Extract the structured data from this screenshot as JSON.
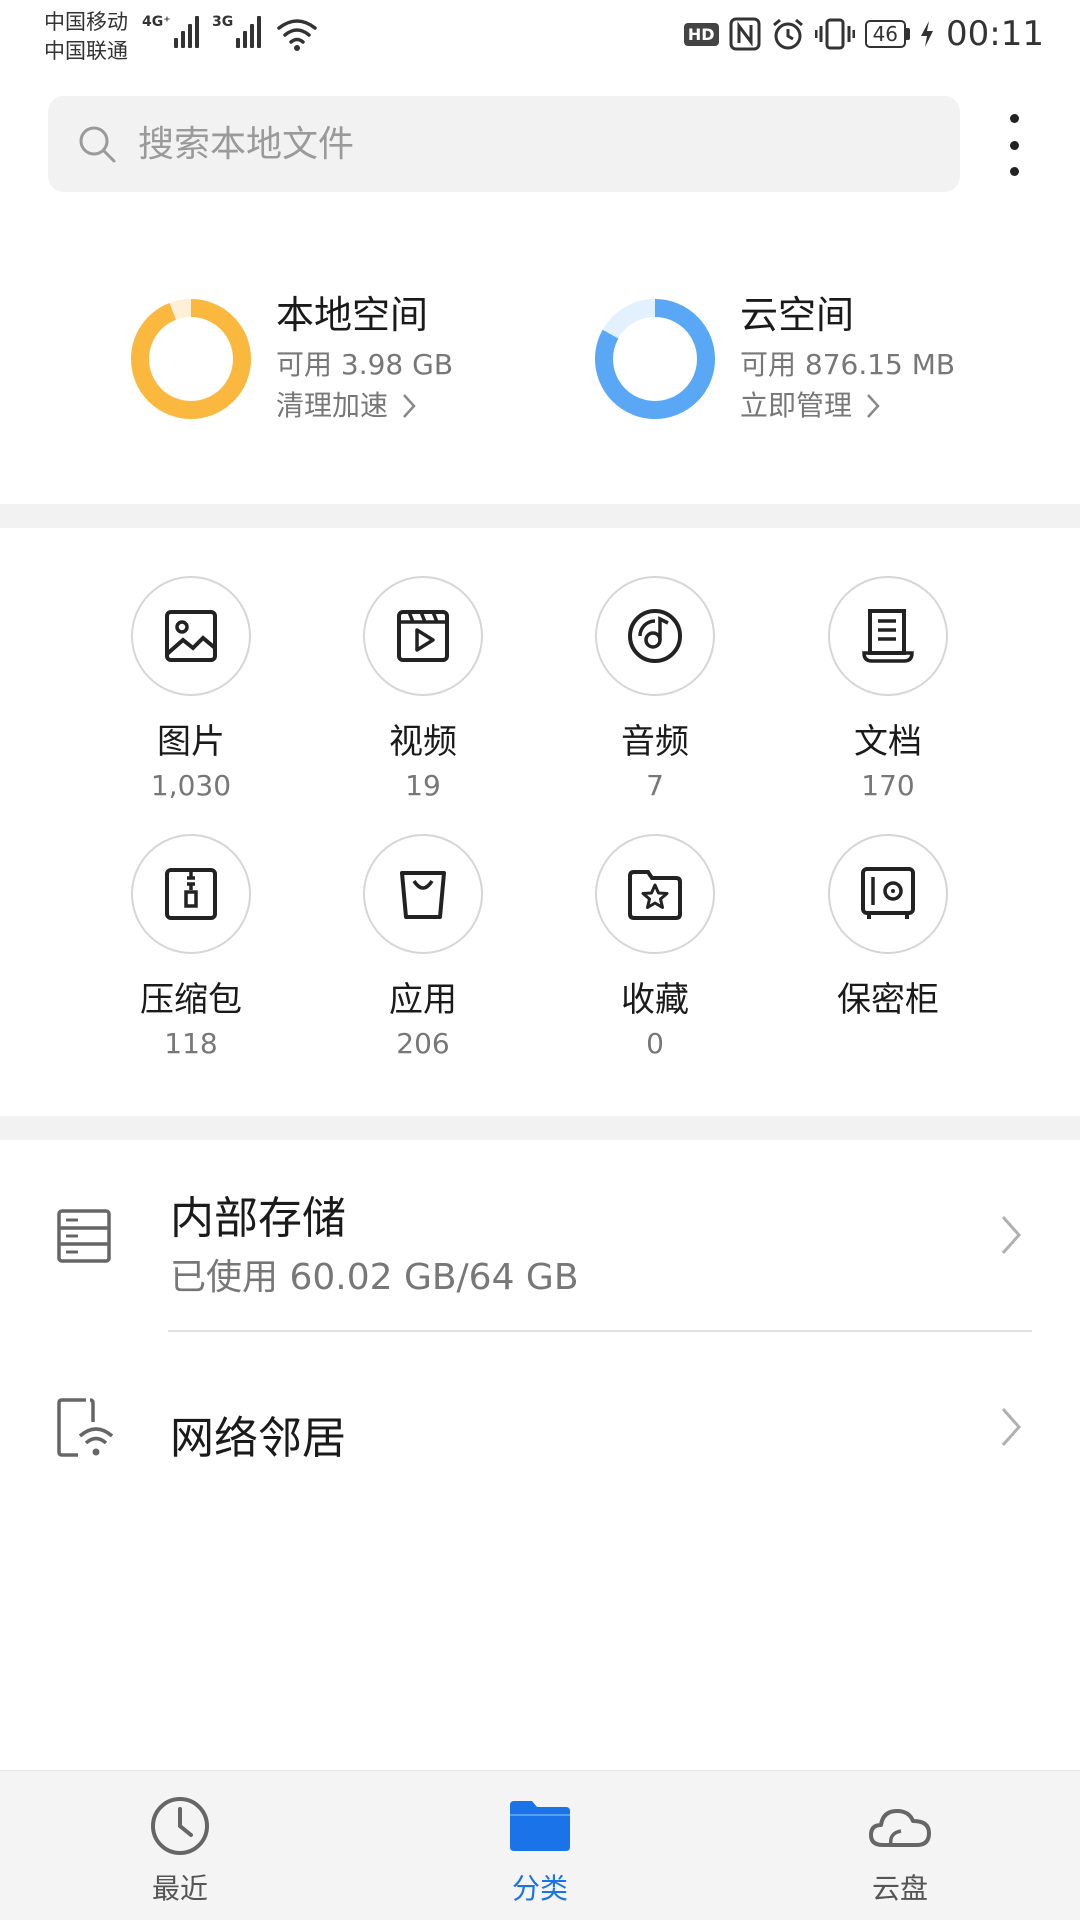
{
  "status_bar": {
    "carrier_1": "中国移动",
    "carrier_2": "中国联通",
    "sim1_network": "4G⁺",
    "sim2_network": "3G",
    "hd_badge": "HD",
    "battery": "46",
    "time": "00:11"
  },
  "search": {
    "placeholder": "搜索本地文件",
    "icon": "search-icon"
  },
  "menu": {
    "icon": "more-vertical-icon"
  },
  "storage": {
    "local": {
      "title": "本地空间",
      "available": "可用 3.98 GB",
      "action": "清理加速",
      "used_fraction": 0.94,
      "color": "#FBB83F",
      "track_color": "#FDF0D6"
    },
    "cloud": {
      "title": "云空间",
      "available": "可用 876.15 MB",
      "action": "立即管理",
      "used_fraction": 0.83,
      "color": "#5AA8F5",
      "track_color": "#E3F0FD"
    }
  },
  "categories": [
    {
      "label": "图片",
      "count": "1,030",
      "icon": "image-icon"
    },
    {
      "label": "视频",
      "count": "19",
      "icon": "video-icon"
    },
    {
      "label": "音频",
      "count": "7",
      "icon": "audio-icon"
    },
    {
      "label": "文档",
      "count": "170",
      "icon": "document-icon"
    },
    {
      "label": "压缩包",
      "count": "118",
      "icon": "zip-icon"
    },
    {
      "label": "应用",
      "count": "206",
      "icon": "app-bag-icon"
    },
    {
      "label": "收藏",
      "count": "0",
      "icon": "favorite-folder-icon"
    },
    {
      "label": "保密柜",
      "count": "",
      "icon": "safe-icon"
    }
  ],
  "locations": {
    "internal": {
      "title": "内部存储",
      "usage": "已使用 60.02 GB/64 GB",
      "icon": "storage-icon"
    },
    "network": {
      "title": "网络邻居",
      "icon": "network-neighbor-icon"
    }
  },
  "bottom_nav": {
    "items": [
      {
        "label": "最近",
        "icon": "clock-icon",
        "active": false
      },
      {
        "label": "分类",
        "icon": "folder-icon",
        "active": true
      },
      {
        "label": "云盘",
        "icon": "cloud-icon",
        "active": false
      }
    ],
    "active_color": "#1A73E8",
    "inactive_color": "#555555"
  }
}
